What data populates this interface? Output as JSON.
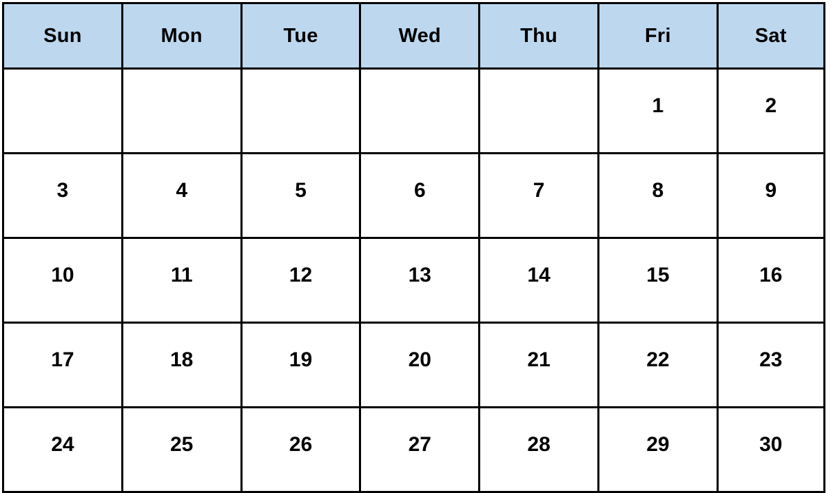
{
  "calendar": {
    "colors": {
      "header_background": "#bdd7ee",
      "grid_border": "#000000",
      "cell_background": "#ffffff",
      "text": "#000000"
    },
    "weekday_headers": [
      {
        "short": "Sun"
      },
      {
        "short": "Mon"
      },
      {
        "short": "Tue"
      },
      {
        "short": "Wed"
      },
      {
        "short": "Thu"
      },
      {
        "short": "Fri"
      },
      {
        "short": "Sat"
      }
    ],
    "weeks": [
      {
        "days": [
          {
            "num": ""
          },
          {
            "num": ""
          },
          {
            "num": ""
          },
          {
            "num": ""
          },
          {
            "num": ""
          },
          {
            "num": "1"
          },
          {
            "num": "2"
          }
        ]
      },
      {
        "days": [
          {
            "num": "3"
          },
          {
            "num": "4"
          },
          {
            "num": "5"
          },
          {
            "num": "6"
          },
          {
            "num": "7"
          },
          {
            "num": "8"
          },
          {
            "num": "9"
          }
        ]
      },
      {
        "days": [
          {
            "num": "10"
          },
          {
            "num": "11"
          },
          {
            "num": "12"
          },
          {
            "num": "13"
          },
          {
            "num": "14"
          },
          {
            "num": "15"
          },
          {
            "num": "16"
          }
        ]
      },
      {
        "days": [
          {
            "num": "17"
          },
          {
            "num": "18"
          },
          {
            "num": "19"
          },
          {
            "num": "20"
          },
          {
            "num": "21"
          },
          {
            "num": "22"
          },
          {
            "num": "23"
          }
        ]
      },
      {
        "days": [
          {
            "num": "24"
          },
          {
            "num": "25"
          },
          {
            "num": "26"
          },
          {
            "num": "27"
          },
          {
            "num": "28"
          },
          {
            "num": "29"
          },
          {
            "num": "30"
          }
        ]
      }
    ]
  }
}
